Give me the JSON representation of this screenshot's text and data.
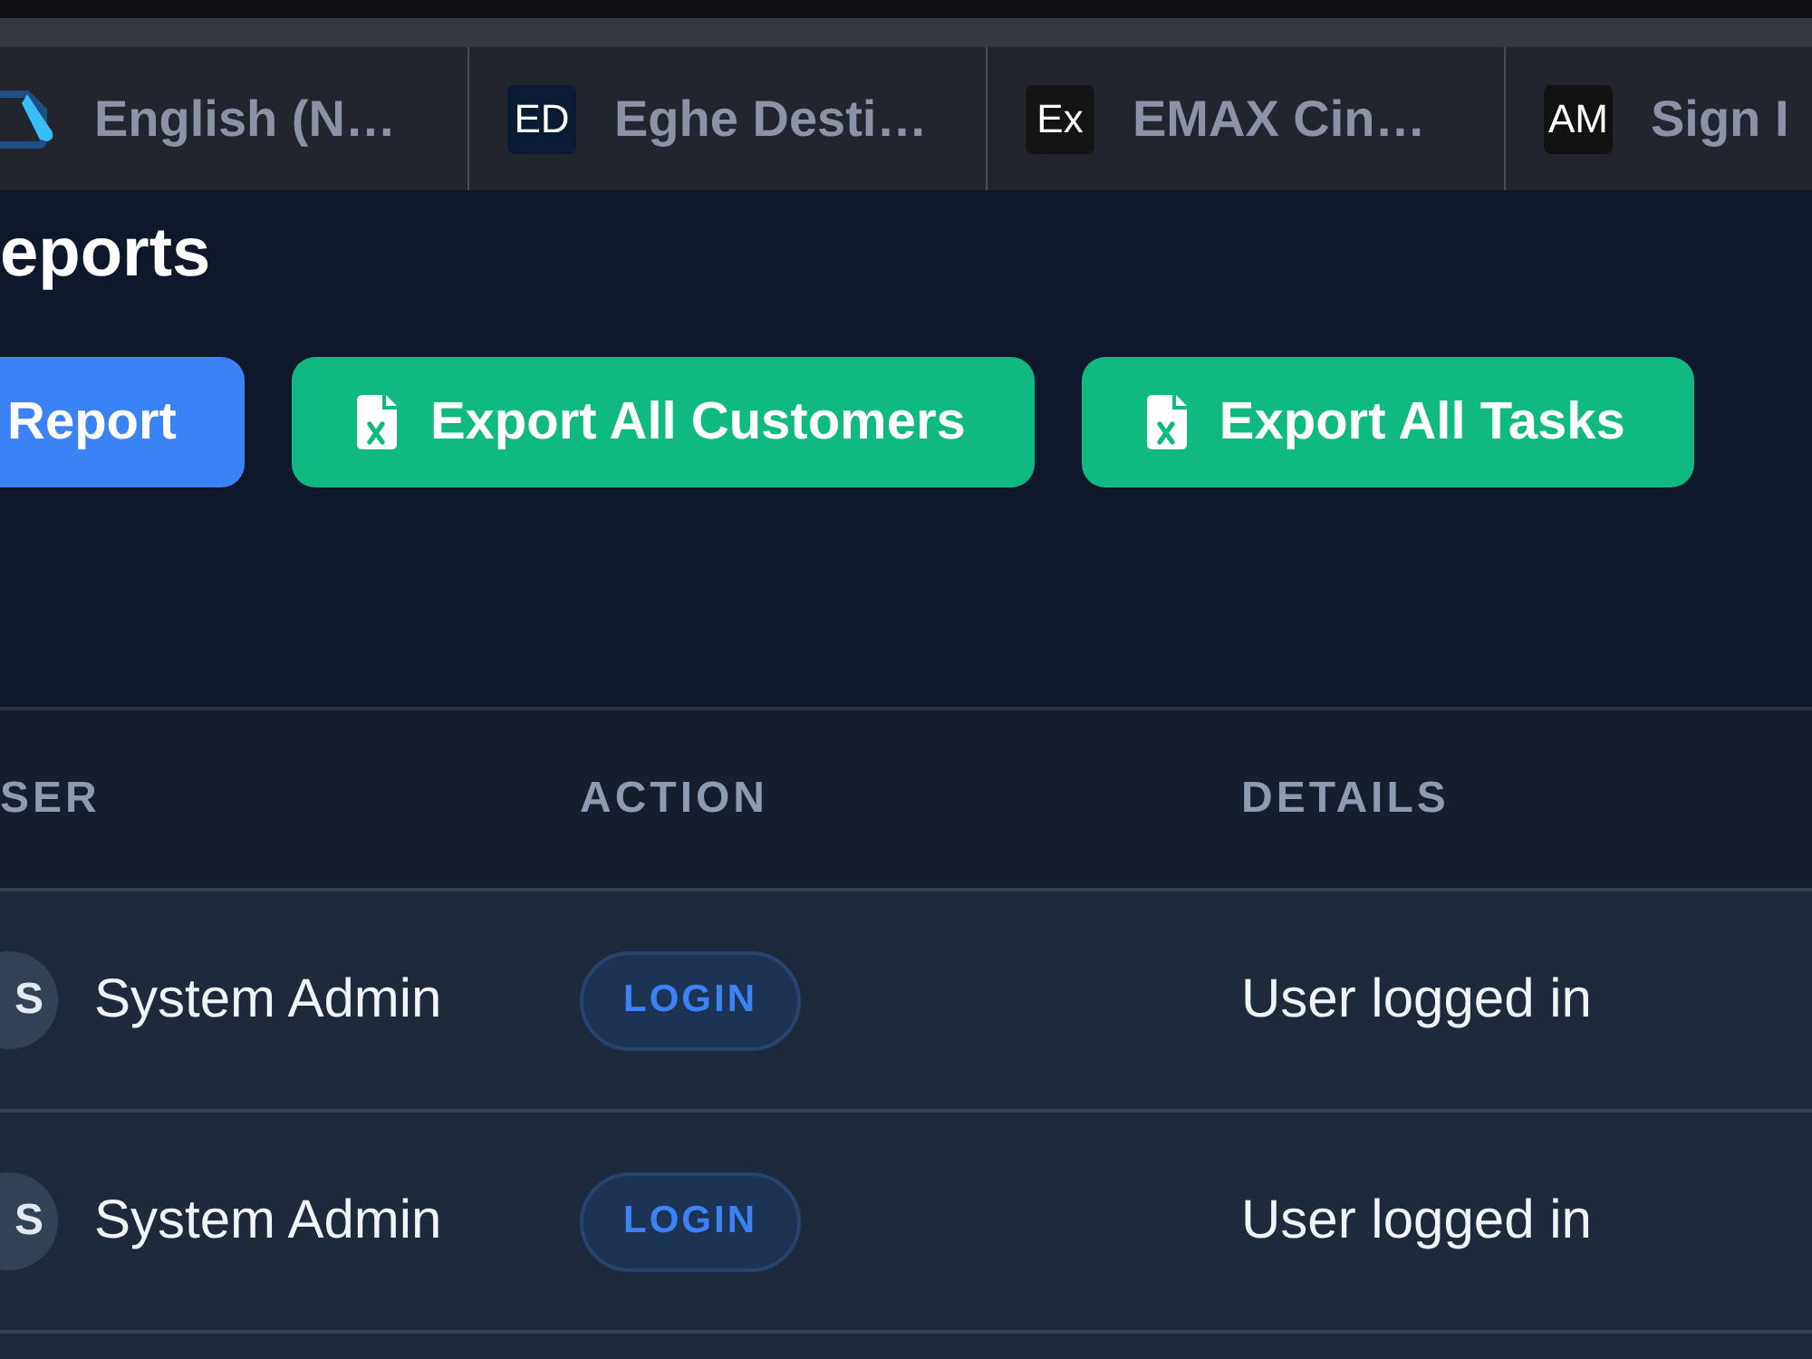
{
  "tabs": [
    {
      "kind": "logo",
      "title": "English (N…"
    },
    {
      "kind": "initials",
      "initials": "ED",
      "color": "#0b1a33",
      "title": "Eghe Desti…"
    },
    {
      "kind": "initials",
      "initials": "Ex",
      "color": "#141414",
      "title": "EMAX Cin…"
    },
    {
      "kind": "initials",
      "initials": "AM",
      "color": "#111111",
      "title": "Sign I"
    }
  ],
  "page": {
    "title": "eports"
  },
  "actions": [
    {
      "kind": "primary",
      "label": "Report"
    },
    {
      "kind": "export",
      "label": "Export All Customers"
    },
    {
      "kind": "export",
      "label": "Export All Tasks"
    }
  ],
  "table": {
    "columns": [
      "SER",
      "ACTION",
      "DETAILS"
    ],
    "rows": [
      {
        "avatar": "S",
        "user": "System Admin",
        "action": "LOGIN",
        "details": "User logged in"
      },
      {
        "avatar": "S",
        "user": "System Admin",
        "action": "LOGIN",
        "details": "User logged in"
      }
    ]
  }
}
